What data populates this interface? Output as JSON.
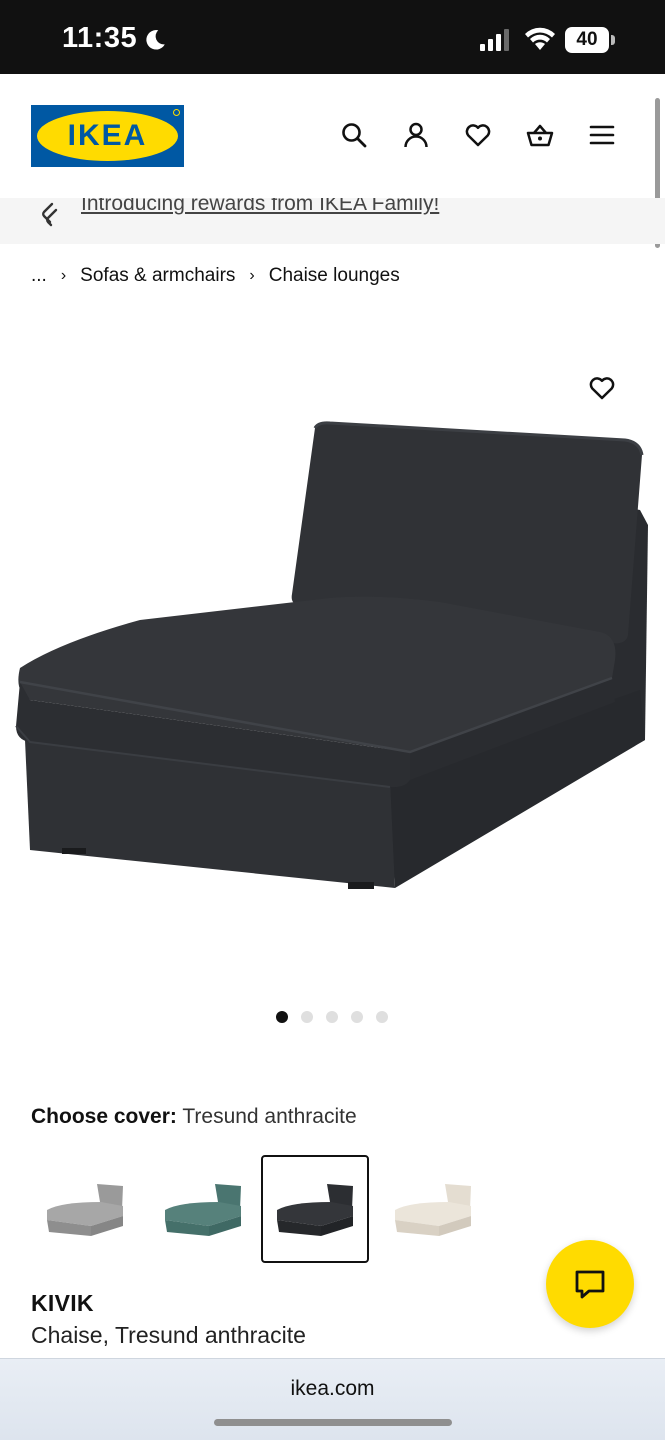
{
  "status_bar": {
    "time": "11:35",
    "battery": "40",
    "icons": [
      "moon-icon",
      "signal-icon",
      "wifi-icon",
      "battery-icon"
    ]
  },
  "header": {
    "logo_text": "IKEA",
    "icons": [
      "search-icon",
      "account-icon",
      "heart-icon",
      "basket-icon",
      "menu-icon"
    ],
    "brand_blue": "#0058a3",
    "brand_yellow": "#ffdb00"
  },
  "promo": {
    "text": "Introducing rewards from IKEA Family!"
  },
  "breadcrumb": {
    "ellipsis": "...",
    "items": [
      "Sofas & armchairs",
      "Chaise lounges"
    ],
    "separator": "›"
  },
  "gallery": {
    "image_count": 5,
    "active_index": 0
  },
  "cover": {
    "label": "Choose cover:",
    "value": "Tresund anthracite",
    "swatch_colors": [
      "#9a9a9a",
      "#4f7a75",
      "#2a2c2f",
      "#e4ddd1"
    ],
    "selected_index": 2
  },
  "product": {
    "name": "KIVIK",
    "description": "Chaise, Tresund anthracite"
  },
  "browser": {
    "url": "ikea.com"
  }
}
